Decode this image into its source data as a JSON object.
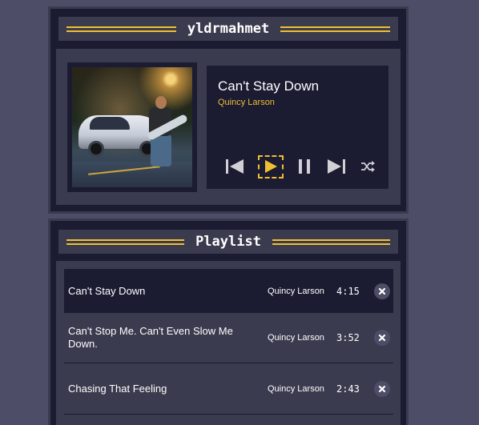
{
  "player": {
    "title": "yldrmahmet",
    "now_playing": {
      "song": "Can't Stay Down",
      "artist": "Quincy Larson"
    },
    "controls": [
      {
        "name": "previous-button",
        "icon": "skip-previous-icon"
      },
      {
        "name": "play-button",
        "icon": "play-icon"
      },
      {
        "name": "pause-button",
        "icon": "pause-icon"
      },
      {
        "name": "next-button",
        "icon": "skip-next-icon"
      },
      {
        "name": "shuffle-button",
        "icon": "shuffle-icon"
      }
    ]
  },
  "playlist": {
    "title": "Playlist",
    "tracks": [
      {
        "title": "Can't Stay Down",
        "artist": "Quincy Larson",
        "duration": "4:15",
        "active": true
      },
      {
        "title": "Can't Stop Me. Can't Even Slow Me Down.",
        "artist": "Quincy Larson",
        "duration": "3:52",
        "active": false
      },
      {
        "title": "Chasing That Feeling",
        "artist": "Quincy Larson",
        "duration": "2:43",
        "active": false
      }
    ]
  },
  "colors": {
    "accent": "#f1be32",
    "background": "#4d4d67",
    "panel_dark": "#1b1b32",
    "panel_mid": "#3b3b4f"
  }
}
